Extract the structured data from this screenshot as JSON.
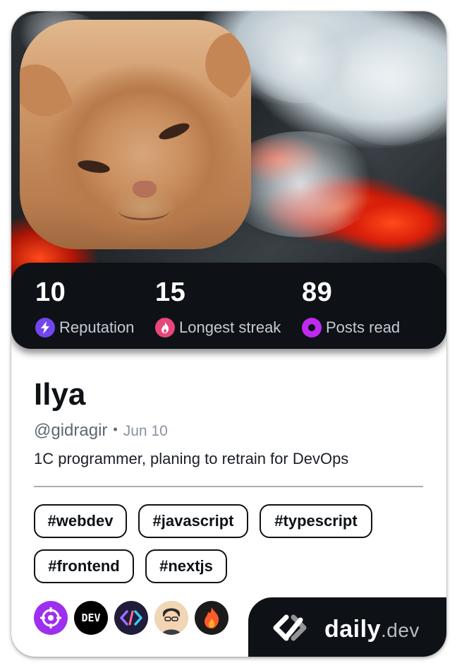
{
  "stats": [
    {
      "value": "10",
      "label": "Reputation",
      "icon": "reputation-bolt-icon",
      "color": "#7147ed"
    },
    {
      "value": "15",
      "label": "Longest streak",
      "icon": "streak-flame-icon",
      "color": "#e8467b"
    },
    {
      "value": "89",
      "label": "Posts read",
      "icon": "posts-read-ring-icon",
      "color": "#c029f0"
    }
  ],
  "profile": {
    "name": "Ilya",
    "handle": "@gidragir",
    "separator": "•",
    "joined": "Jun 10",
    "bio": "1C programmer, planing to retrain for DevOps"
  },
  "tags": [
    "#webdev",
    "#javascript",
    "#typescript",
    "#frontend",
    "#nextjs"
  ],
  "badges": [
    {
      "icon": "target-crosshair-icon",
      "color": "#9d2ff0"
    },
    {
      "icon": "dev-to-icon",
      "color": "#000000",
      "text": "DEV"
    },
    {
      "icon": "code-brackets-icon",
      "color": "#1f1d3a"
    },
    {
      "icon": "avatar-icon",
      "color": "#e6c9a3"
    },
    {
      "icon": "flame-icon",
      "color": "#1b1b1b"
    }
  ],
  "brand": {
    "name": "daily",
    "tld": ".dev",
    "icon": "daily-dev-logo-icon"
  }
}
